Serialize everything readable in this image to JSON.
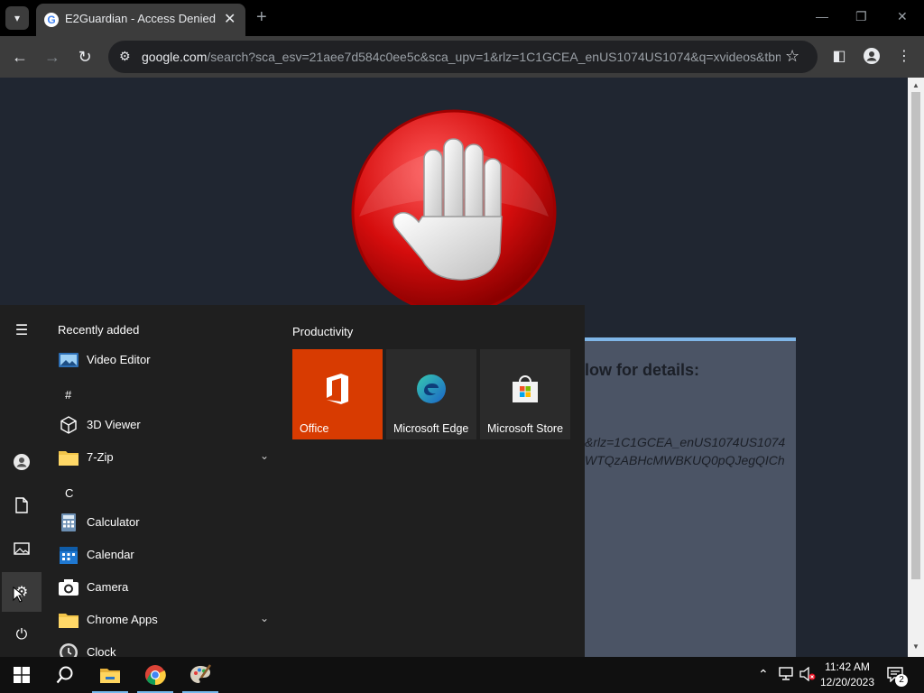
{
  "browser": {
    "tab_title": "E2Guardian - Access Denied",
    "new_tab_symbol": "+",
    "url_host": "google.com",
    "url_rest": "/search?sca_esv=21aee7d584c0ee5c&sca_upv=1&rlz=1C1GCEA_enUS1074US1074&q=xvideos&tbm..."
  },
  "page": {
    "info_heading": "low for details:",
    "info_line1": "&rlz=1C1GCEA_enUS1074US1074",
    "info_line2": "WTQzABHcMWBKUQ0pQJegQICh"
  },
  "start_menu": {
    "recently_added_label": "Recently added",
    "apps": [
      {
        "label": "Video Editor",
        "icon": "video-editor-icon"
      },
      {
        "header": "#"
      },
      {
        "label": "3D Viewer",
        "icon": "cube-icon"
      },
      {
        "label": "7-Zip",
        "icon": "folder-icon",
        "expandable": true
      },
      {
        "header": "C"
      },
      {
        "label": "Calculator",
        "icon": "calculator-icon"
      },
      {
        "label": "Calendar",
        "icon": "calendar-icon"
      },
      {
        "label": "Camera",
        "icon": "camera-icon"
      },
      {
        "label": "Chrome Apps",
        "icon": "folder-icon",
        "expandable": true
      },
      {
        "label": "Clock",
        "icon": "clock-icon"
      }
    ],
    "productivity_label": "Productivity",
    "tiles": [
      {
        "label": "Office",
        "color": "#d83b01"
      },
      {
        "label": "Microsoft Edge",
        "color": "#2b2b2b"
      },
      {
        "label": "Microsoft Store",
        "color": "#2b2b2b"
      }
    ]
  },
  "taskbar": {
    "time": "11:42 AM",
    "date": "12/20/2023",
    "notification_count": "2"
  },
  "colors": {
    "accent": "#76b9ed",
    "office_tile": "#d83b01",
    "page_bg": "#202631"
  }
}
